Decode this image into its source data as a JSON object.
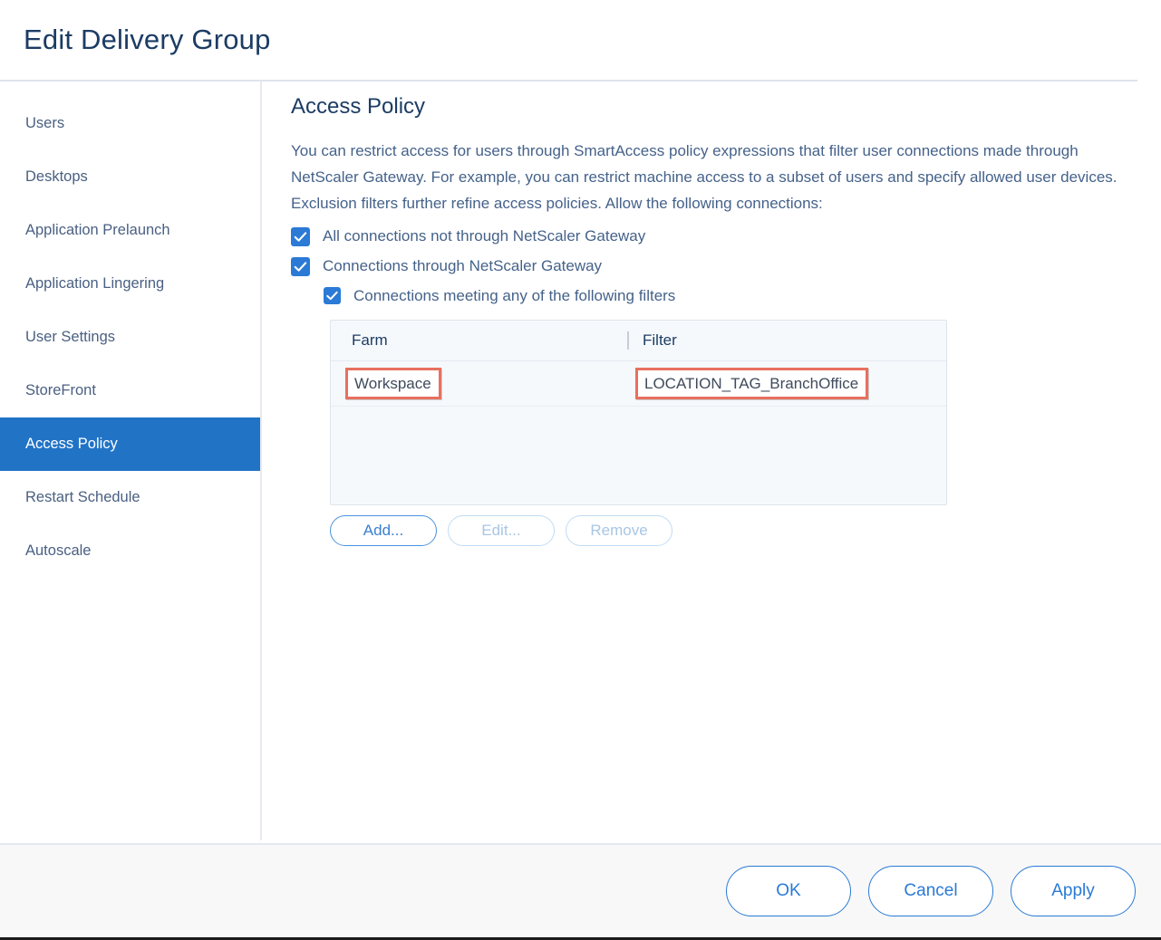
{
  "dialog": {
    "title": "Edit Delivery Group"
  },
  "sidebar": {
    "items": [
      {
        "label": "Users",
        "selected": false
      },
      {
        "label": "Desktops",
        "selected": false
      },
      {
        "label": "Application Prelaunch",
        "selected": false
      },
      {
        "label": "Application Lingering",
        "selected": false
      },
      {
        "label": "User Settings",
        "selected": false
      },
      {
        "label": "StoreFront",
        "selected": false
      },
      {
        "label": "Access Policy",
        "selected": true
      },
      {
        "label": "Restart Schedule",
        "selected": false
      },
      {
        "label": "Autoscale",
        "selected": false
      }
    ]
  },
  "content": {
    "heading": "Access Policy",
    "description": "You can restrict access for users through SmartAccess policy expressions that filter user connections made through NetScaler Gateway. For example, you can restrict machine access to a subset of users and specify allowed user devices. Exclusion filters further refine access policies. Allow the following connections:",
    "checkboxes": {
      "all_connections": {
        "label": "All connections not through NetScaler Gateway",
        "checked": true
      },
      "gateway_connections": {
        "label": "Connections through NetScaler Gateway",
        "checked": true
      },
      "meeting_filters": {
        "label": "Connections meeting any of the following filters",
        "checked": true
      }
    },
    "table": {
      "columns": [
        "Farm",
        "Filter"
      ],
      "rows": [
        {
          "farm": "Workspace",
          "filter": "LOCATION_TAG_BranchOffice",
          "highlighted": true
        }
      ]
    },
    "table_buttons": {
      "add": {
        "label": "Add...",
        "enabled": true
      },
      "edit": {
        "label": "Edit...",
        "enabled": false
      },
      "remove": {
        "label": "Remove",
        "enabled": false
      }
    }
  },
  "footer": {
    "ok": "OK",
    "cancel": "Cancel",
    "apply": "Apply"
  },
  "colors": {
    "accent_blue": "#2a7ad6",
    "selected_nav": "#2173c6",
    "title_navy": "#1c3c64",
    "body_text": "#45628a",
    "highlight_red": "#e8705f",
    "table_bg": "#f6f9fc",
    "footer_bg": "#f8f8f8"
  }
}
